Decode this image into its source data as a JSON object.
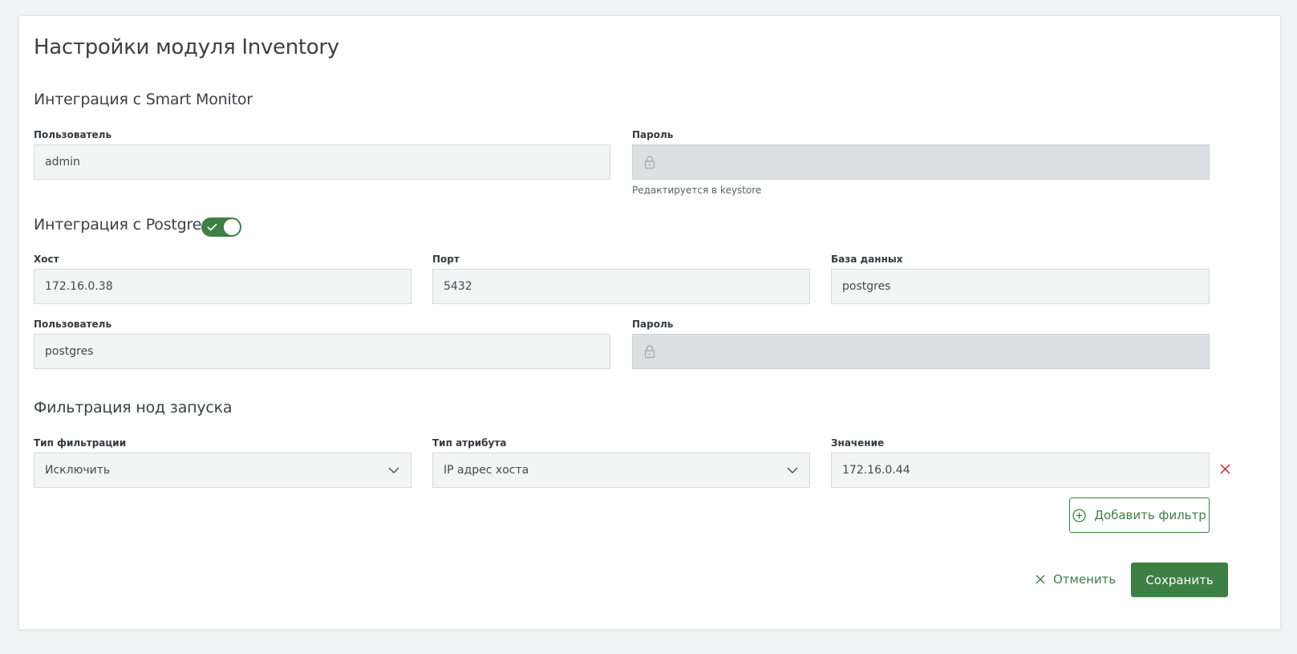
{
  "page": {
    "title": "Настройки модуля Inventory"
  },
  "smart_monitor": {
    "title": "Интеграция с Smart Monitor",
    "user_label": "Пользователь",
    "user_value": "admin",
    "password_label": "Пароль",
    "password_hint": "Редактируется в keystore"
  },
  "postgres": {
    "title": "Интеграция с Postgres",
    "enabled": true,
    "host_label": "Хост",
    "host_value": "172.16.0.38",
    "port_label": "Порт",
    "port_value": "5432",
    "db_label": "База данных",
    "db_value": "postgres",
    "user_label": "Пользователь",
    "user_value": "postgres",
    "password_label": "Пароль"
  },
  "filters": {
    "title": "Фильтрация нод запуска",
    "type_label": "Тип фильтрации",
    "type_value": "Исключить",
    "attr_label": "Тип атрибута",
    "attr_value": "IP адрес хоста",
    "value_label": "Значение",
    "value_value": "172.16.0.44",
    "add_label": "Добавить фильтр"
  },
  "actions": {
    "cancel_label": "Отменить",
    "save_label": "Сохранить"
  },
  "colors": {
    "accent": "#3d7f44",
    "danger": "#d9363e",
    "background": "#f1f2f3",
    "field_bg": "#f3f4f4",
    "locked_bg": "#dde0e2"
  },
  "icons": [
    "lock-icon",
    "check-icon",
    "chevron-down-icon",
    "close-icon",
    "plus-circle-icon"
  ]
}
